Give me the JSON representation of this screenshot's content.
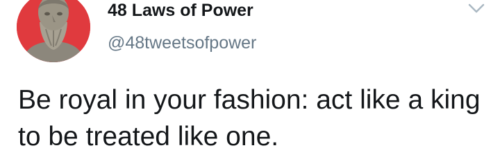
{
  "tweet": {
    "author": {
      "display_name": "48 Laws of Power",
      "handle": "@48tweetsofpower",
      "avatar_icon": "bust-statue-avatar",
      "avatar_bg_color": "#e03a3e"
    },
    "menu_icon": "chevron-down-icon",
    "text": "Be royal in your fashion: act like a king to be treated like one."
  }
}
